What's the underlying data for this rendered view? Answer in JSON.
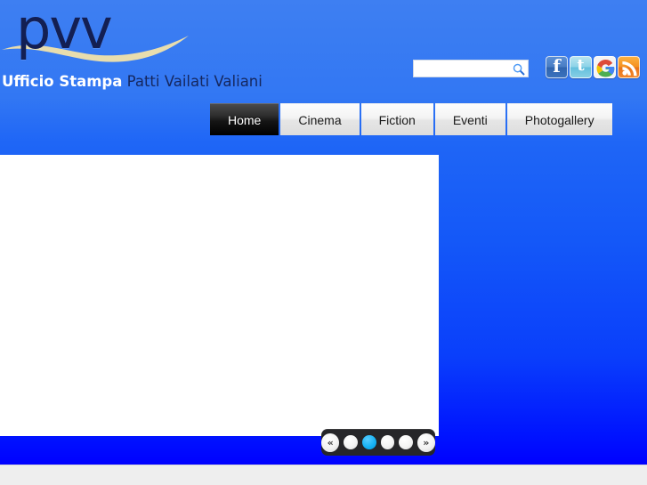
{
  "site": {
    "background_top_color": "#3e7ff2",
    "background_bottom_color": "#0000ff"
  },
  "header": {
    "logo": {
      "wordmark": "pvv",
      "wordmark_color": "#131f53",
      "swoosh_color": "#e8ddae",
      "tagline_strong": "Ufficio Stampa",
      "tagline_light": "Patti Vailati Valiani",
      "tagline_strong_color": "#ffffff",
      "tagline_light_color": "#15275e"
    },
    "search": {
      "value": "",
      "placeholder": "",
      "icon": "search-icon"
    },
    "social": [
      {
        "name": "facebook-icon",
        "label": "Facebook",
        "color": "#3a72bd"
      },
      {
        "name": "twitter-icon",
        "label": "Twitter",
        "color": "#63bfdd"
      },
      {
        "name": "googleplus-icon",
        "label": "Google Plus",
        "color": "#dd4b39"
      },
      {
        "name": "rss-icon",
        "label": "RSS",
        "color": "#f2862a"
      }
    ]
  },
  "nav": {
    "items": [
      {
        "label": "Home",
        "active": true
      },
      {
        "label": "Cinema",
        "active": false
      },
      {
        "label": "Fiction",
        "active": false
      },
      {
        "label": "Eventi",
        "active": false
      },
      {
        "label": "Photogallery",
        "active": false
      }
    ]
  },
  "slider": {
    "panel_background": "#ffffff",
    "pagination": {
      "prev_label": "«",
      "next_label": "»",
      "dots": [
        {
          "active": false
        },
        {
          "active": true
        },
        {
          "active": false
        },
        {
          "active": false
        }
      ],
      "active_dot_color": "#17b3f5",
      "track_color": "#262629"
    }
  },
  "footer": {
    "background": "#eeeeee"
  }
}
